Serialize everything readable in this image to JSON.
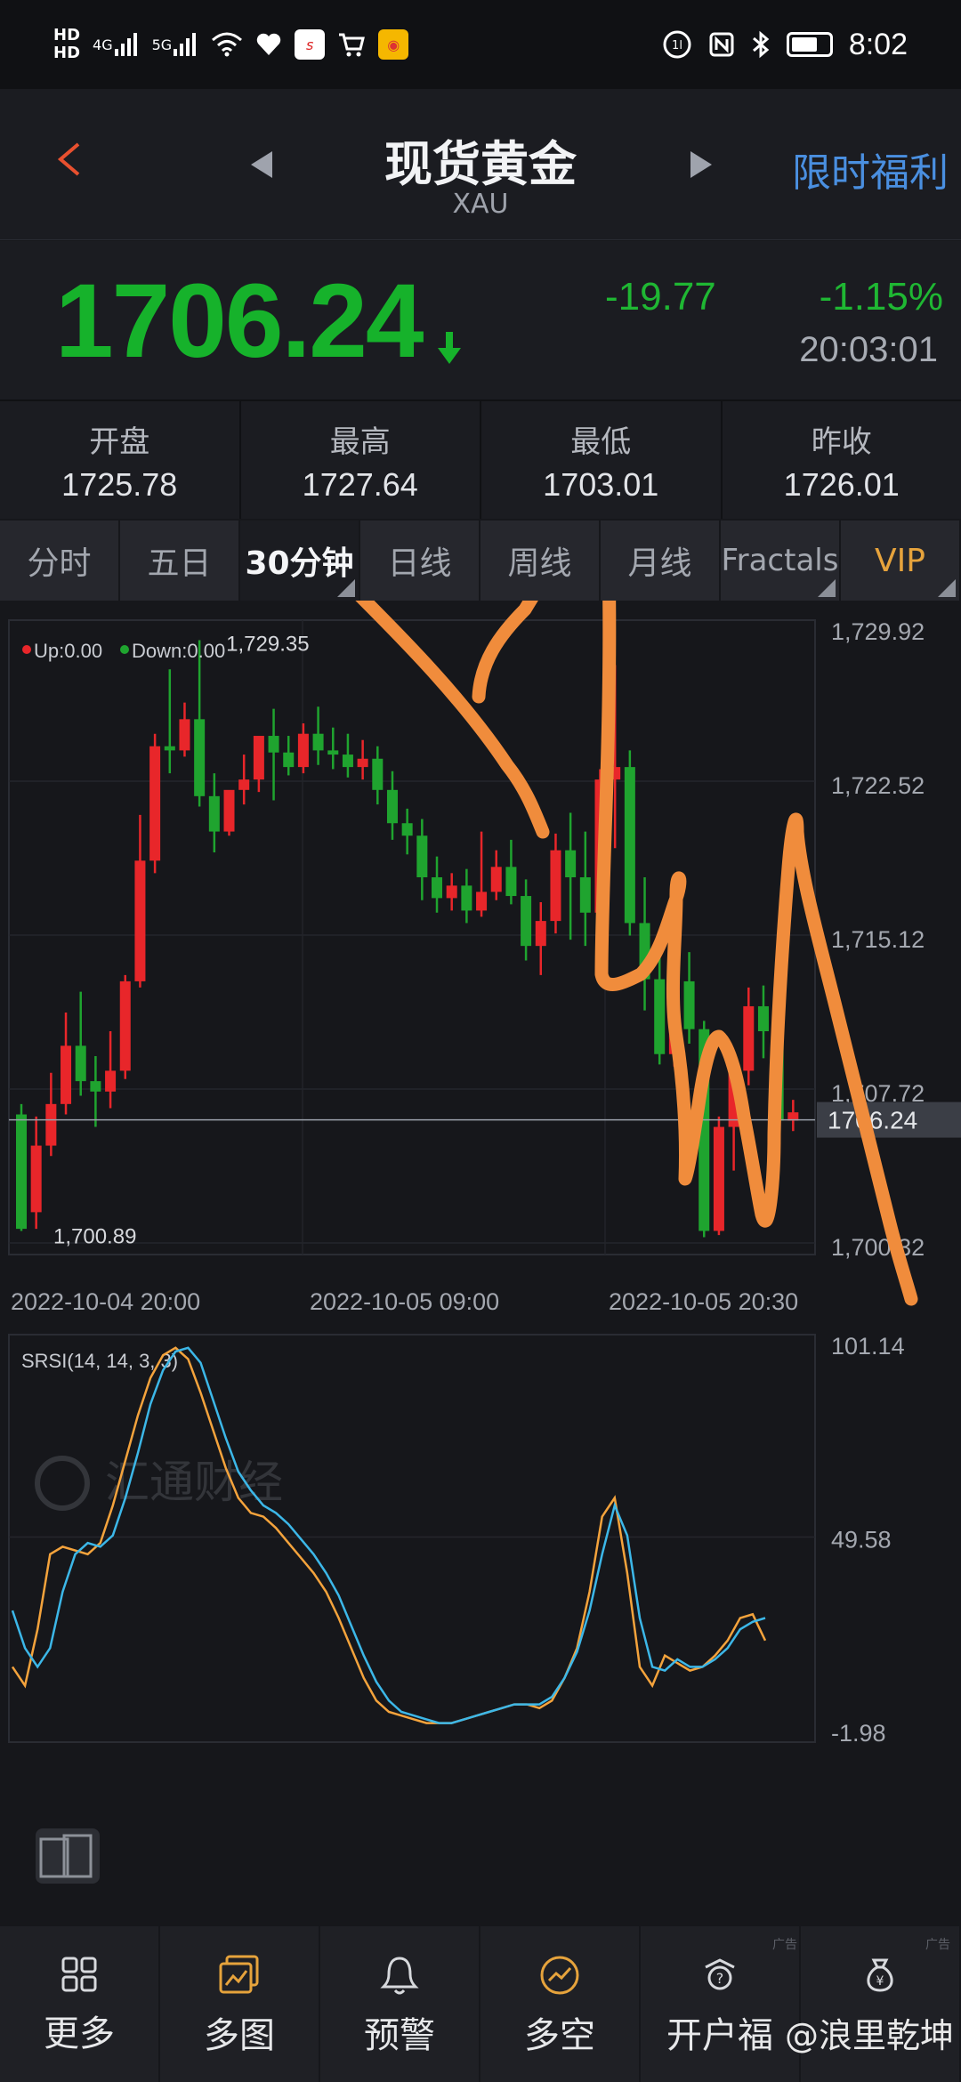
{
  "status_bar": {
    "hd1": "HD",
    "hd2": "HD",
    "net1": "4G",
    "net2": "5G",
    "time": "8:02"
  },
  "header": {
    "title": "现货黄金",
    "subtitle": "XAU",
    "promo": "限时福利"
  },
  "quote": {
    "price": "1706.24",
    "change": "-19.77",
    "change_pct": "-1.15%",
    "time": "20:03:01"
  },
  "stats": [
    {
      "label": "开盘",
      "value": "1725.78"
    },
    {
      "label": "最高",
      "value": "1727.64"
    },
    {
      "label": "最低",
      "value": "1703.01"
    },
    {
      "label": "昨收",
      "value": "1726.01"
    }
  ],
  "tabs": [
    {
      "label": "分时",
      "active": false
    },
    {
      "label": "五日",
      "active": false
    },
    {
      "label": "30分钟",
      "active": true
    },
    {
      "label": "日线",
      "active": false
    },
    {
      "label": "周线",
      "active": false
    },
    {
      "label": "月线",
      "active": false
    },
    {
      "label": "Fractals",
      "active": false
    },
    {
      "label": "VIP",
      "active": false
    }
  ],
  "chart_data": [
    {
      "type": "candlestick",
      "legend": {
        "up": "Up:0.00",
        "down": "Down:0.00"
      },
      "y_ticks": [
        "1,729.92",
        "1,722.52",
        "1,715.12",
        "1,707.72",
        "1,700.32"
      ],
      "ylim": [
        1700.32,
        1729.92
      ],
      "x_ticks": [
        "2022-10-04 20:00",
        "2022-10-05 09:00",
        "2022-10-05 20:30"
      ],
      "current_price_label": "1706.24",
      "current_price": 1706.24,
      "high_annotation": "1,729.35",
      "low_annotation": "1,700.89",
      "watermark": "汇通财经",
      "up_color": "#e8262a",
      "down_color": "#1fa42f",
      "candles": [
        {
          "o": 1706.5,
          "h": 1707.0,
          "c": 1701.0,
          "l": 1700.9
        },
        {
          "o": 1701.8,
          "h": 1706.4,
          "c": 1705.0,
          "l": 1701.0
        },
        {
          "o": 1705.0,
          "h": 1708.5,
          "c": 1707.0,
          "l": 1704.5
        },
        {
          "o": 1707.0,
          "h": 1711.4,
          "c": 1709.8,
          "l": 1706.5
        },
        {
          "o": 1709.8,
          "h": 1712.4,
          "c": 1708.1,
          "l": 1707.4
        },
        {
          "o": 1708.1,
          "h": 1709.3,
          "c": 1707.6,
          "l": 1705.9
        },
        {
          "o": 1707.6,
          "h": 1710.5,
          "c": 1708.6,
          "l": 1706.8
        },
        {
          "o": 1708.6,
          "h": 1713.2,
          "c": 1712.9,
          "l": 1708.2
        },
        {
          "o": 1712.9,
          "h": 1720.9,
          "c": 1718.7,
          "l": 1712.6
        },
        {
          "o": 1718.7,
          "h": 1724.8,
          "c": 1724.2,
          "l": 1718.1
        },
        {
          "o": 1724.2,
          "h": 1727.9,
          "c": 1724.0,
          "l": 1722.9
        },
        {
          "o": 1724.0,
          "h": 1726.3,
          "c": 1725.5,
          "l": 1723.7
        },
        {
          "o": 1725.5,
          "h": 1729.3,
          "c": 1721.8,
          "l": 1721.3
        },
        {
          "o": 1721.8,
          "h": 1722.9,
          "c": 1720.1,
          "l": 1719.1
        },
        {
          "o": 1720.1,
          "h": 1721.3,
          "c": 1722.1,
          "l": 1719.9
        },
        {
          "o": 1722.1,
          "h": 1723.8,
          "c": 1722.6,
          "l": 1721.4
        },
        {
          "o": 1722.6,
          "h": 1724.4,
          "c": 1724.7,
          "l": 1722.0
        },
        {
          "o": 1724.7,
          "h": 1726.0,
          "c": 1723.9,
          "l": 1721.6
        },
        {
          "o": 1723.9,
          "h": 1724.7,
          "c": 1723.2,
          "l": 1722.8
        },
        {
          "o": 1723.2,
          "h": 1725.3,
          "c": 1724.8,
          "l": 1722.9
        },
        {
          "o": 1724.8,
          "h": 1726.1,
          "c": 1724.0,
          "l": 1723.3
        },
        {
          "o": 1724.0,
          "h": 1725.1,
          "c": 1723.8,
          "l": 1723.1
        },
        {
          "o": 1723.8,
          "h": 1724.8,
          "c": 1723.2,
          "l": 1722.7
        },
        {
          "o": 1723.2,
          "h": 1724.5,
          "c": 1723.6,
          "l": 1722.6
        },
        {
          "o": 1723.6,
          "h": 1724.2,
          "c": 1722.1,
          "l": 1721.4
        },
        {
          "o": 1722.1,
          "h": 1723.0,
          "c": 1720.5,
          "l": 1719.7
        },
        {
          "o": 1720.5,
          "h": 1721.2,
          "c": 1719.9,
          "l": 1719.0
        },
        {
          "o": 1719.9,
          "h": 1720.7,
          "c": 1717.9,
          "l": 1716.8
        },
        {
          "o": 1717.9,
          "h": 1718.9,
          "c": 1716.9,
          "l": 1716.2
        },
        {
          "o": 1716.9,
          "h": 1718.1,
          "c": 1717.5,
          "l": 1716.3
        },
        {
          "o": 1717.5,
          "h": 1718.3,
          "c": 1716.3,
          "l": 1715.7
        },
        {
          "o": 1716.3,
          "h": 1720.1,
          "c": 1717.2,
          "l": 1716.0
        },
        {
          "o": 1717.2,
          "h": 1719.2,
          "c": 1718.4,
          "l": 1716.8
        },
        {
          "o": 1718.4,
          "h": 1719.7,
          "c": 1717.0,
          "l": 1716.6
        },
        {
          "o": 1717.0,
          "h": 1717.8,
          "c": 1714.6,
          "l": 1713.9
        },
        {
          "o": 1714.6,
          "h": 1716.7,
          "c": 1715.8,
          "l": 1713.2
        },
        {
          "o": 1715.8,
          "h": 1720.0,
          "c": 1719.2,
          "l": 1715.2
        },
        {
          "o": 1719.2,
          "h": 1721.0,
          "c": 1717.9,
          "l": 1714.9
        },
        {
          "o": 1717.9,
          "h": 1720.1,
          "c": 1716.2,
          "l": 1714.6
        },
        {
          "o": 1716.2,
          "h": 1723.1,
          "c": 1722.6,
          "l": 1716.0
        },
        {
          "o": 1722.6,
          "h": 1728.1,
          "c": 1723.2,
          "l": 1719.3
        },
        {
          "o": 1723.2,
          "h": 1724.0,
          "c": 1715.7,
          "l": 1715.1
        },
        {
          "o": 1715.7,
          "h": 1717.9,
          "c": 1713.0,
          "l": 1711.5
        },
        {
          "o": 1713.0,
          "h": 1715.1,
          "c": 1709.4,
          "l": 1708.9
        },
        {
          "o": 1709.4,
          "h": 1713.2,
          "c": 1712.9,
          "l": 1708.8
        },
        {
          "o": 1712.9,
          "h": 1714.3,
          "c": 1710.6,
          "l": 1709.9
        },
        {
          "o": 1710.6,
          "h": 1711.0,
          "c": 1700.9,
          "l": 1700.6
        },
        {
          "o": 1700.9,
          "h": 1706.4,
          "c": 1705.9,
          "l": 1700.7
        },
        {
          "o": 1705.9,
          "h": 1708.9,
          "c": 1708.6,
          "l": 1703.8
        },
        {
          "o": 1708.6,
          "h": 1712.6,
          "c": 1711.7,
          "l": 1707.9
        },
        {
          "o": 1711.7,
          "h": 1712.7,
          "c": 1710.5,
          "l": 1709.2
        },
        {
          "o": 1710.5,
          "h": 1711.0,
          "c": 1706.2,
          "l": 1705.7
        },
        {
          "o": 1706.2,
          "h": 1707.2,
          "c": 1706.6,
          "l": 1705.7
        }
      ]
    },
    {
      "type": "line",
      "label": "SRSI(14, 14, 3, 3)",
      "y_ticks": [
        "101.14",
        "49.58",
        "-1.98"
      ],
      "ylim": [
        -1.98,
        101.14
      ],
      "series": [
        {
          "color": "#f4a33c",
          "values": [
            15,
            10,
            25,
            45,
            47,
            46,
            45,
            48,
            58,
            70,
            82,
            92,
            98,
            100,
            97,
            88,
            78,
            68,
            60,
            56,
            55,
            52,
            48,
            44,
            40,
            35,
            28,
            20,
            12,
            6,
            3,
            2,
            1,
            0,
            0,
            0,
            1,
            2,
            3,
            4,
            5,
            5,
            4,
            6,
            12,
            20,
            35,
            55,
            60,
            40,
            15,
            10,
            18,
            16,
            14,
            15,
            18,
            22,
            28,
            29,
            22
          ]
        },
        {
          "color": "#3cb7e8",
          "values": [
            30,
            20,
            15,
            20,
            35,
            45,
            48,
            47,
            50,
            60,
            72,
            85,
            94,
            99,
            100,
            96,
            86,
            76,
            67,
            62,
            58,
            56,
            53,
            49,
            45,
            40,
            34,
            26,
            18,
            11,
            6,
            3,
            2,
            1,
            0,
            0,
            1,
            2,
            3,
            4,
            5,
            5,
            5,
            7,
            12,
            19,
            30,
            45,
            58,
            50,
            28,
            15,
            14,
            17,
            15,
            15,
            17,
            20,
            25,
            27,
            28
          ]
        }
      ]
    }
  ],
  "annotation_scribble_color": "#f08c3c",
  "nav": [
    {
      "label": "更多",
      "icon": "grid-icon"
    },
    {
      "label": "多图",
      "icon": "multi-chart-icon"
    },
    {
      "label": "预警",
      "icon": "bell-icon"
    },
    {
      "label": "多空",
      "icon": "bull-bear-icon"
    },
    {
      "label": "开户福",
      "icon": "gift-icon"
    },
    {
      "label": "",
      "icon": "money-bag-icon"
    }
  ],
  "nav_watermark": "@浪里乾坤",
  "small_ad_1": "广告",
  "small_ad_2": "广告"
}
